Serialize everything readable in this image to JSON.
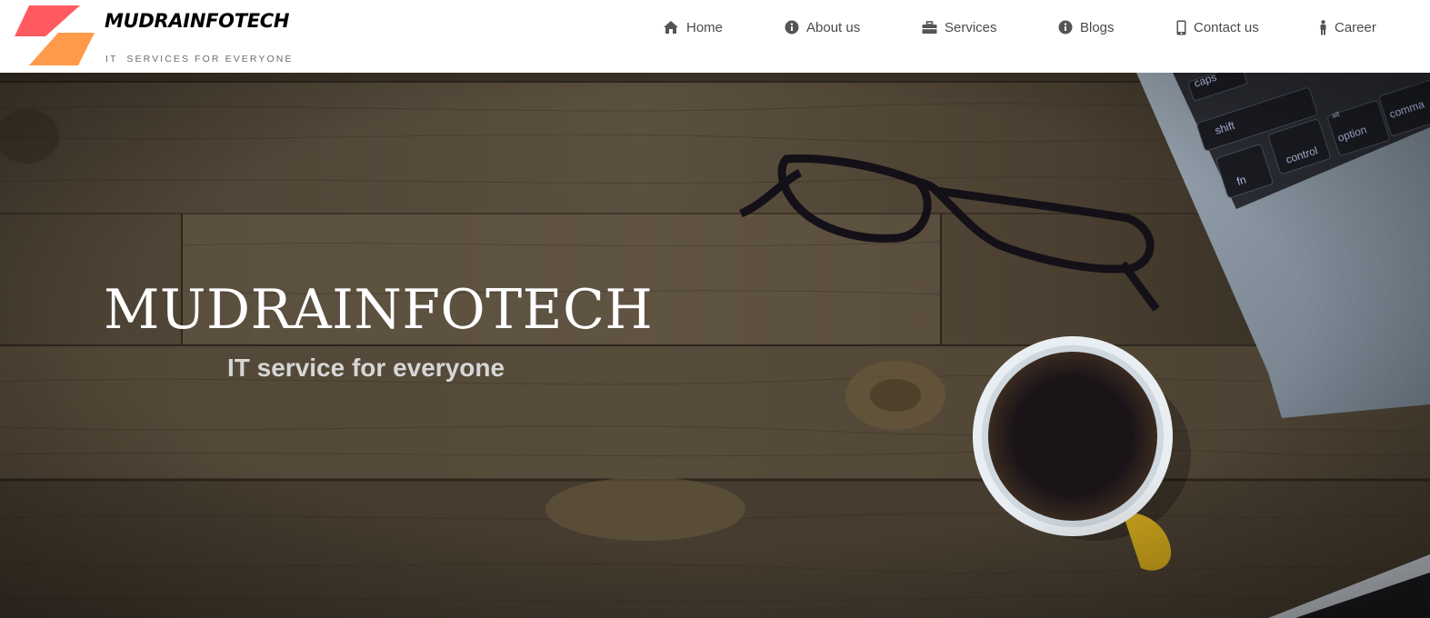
{
  "brand": {
    "name": "MUDRAINFOTECH",
    "tagline": "IT  SERVICES FOR EVERYONE"
  },
  "nav": {
    "items": [
      {
        "label": "Home",
        "icon": "home-icon"
      },
      {
        "label": "About us",
        "icon": "info-icon"
      },
      {
        "label": "Services",
        "icon": "briefcase-icon"
      },
      {
        "label": "Blogs",
        "icon": "info-icon"
      },
      {
        "label": "Contact us",
        "icon": "mobile-phone-icon"
      },
      {
        "label": "Career",
        "icon": "person-icon"
      }
    ]
  },
  "hero": {
    "title": "MUDRAINFOTECH",
    "subtitle": "IT service for everyone",
    "keyboard_keys": [
      "caps",
      "shift",
      "fn",
      "control",
      "alt",
      "option",
      "comma"
    ]
  },
  "colors": {
    "logo_red": "#ff5a5f",
    "logo_orange": "#ff9a4a",
    "nav_text": "#4a4a4a",
    "wood_dark": "#3f3628",
    "hero_title": "#ffffff"
  }
}
